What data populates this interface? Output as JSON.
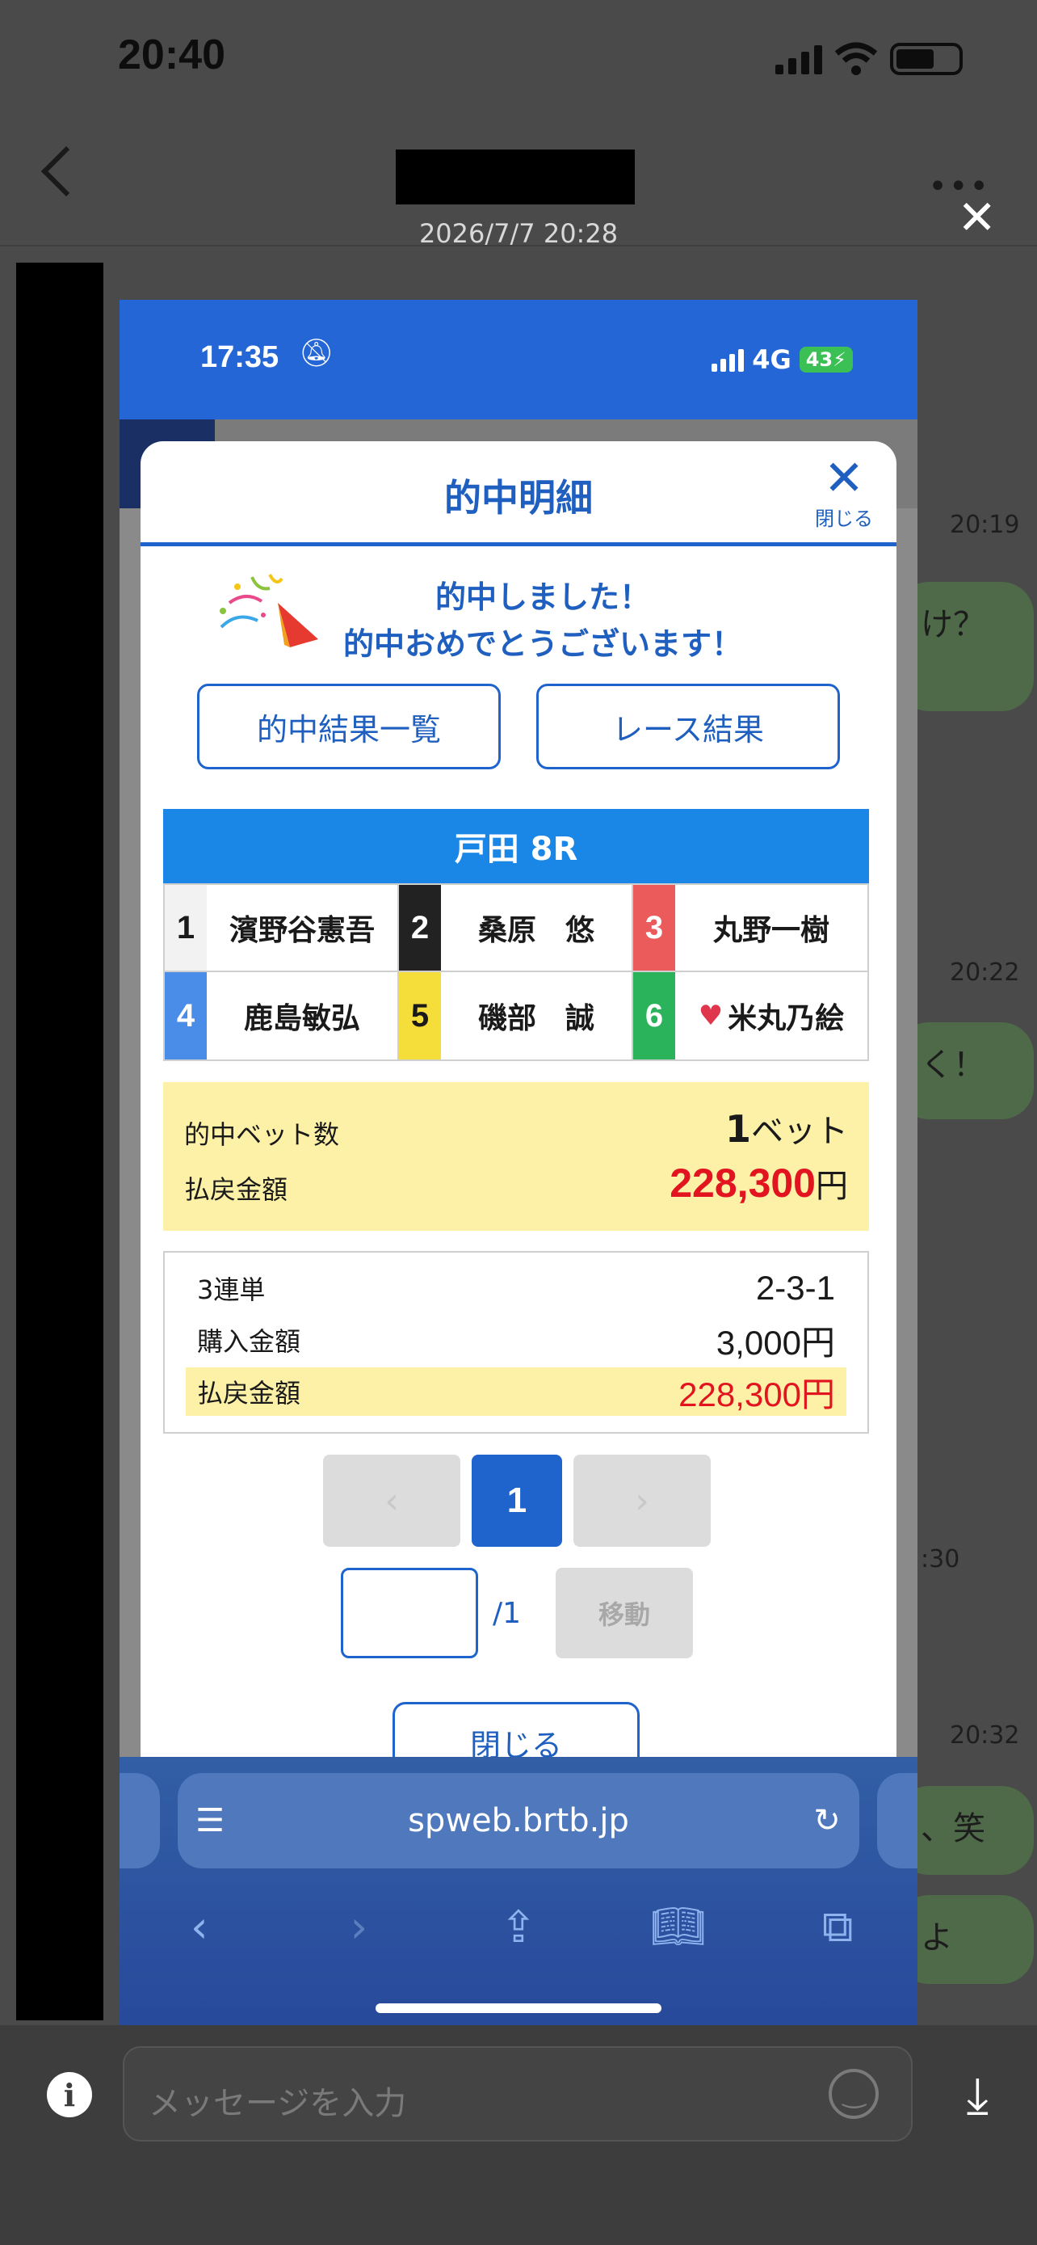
{
  "status": {
    "time": "20:40"
  },
  "chat": {
    "date": "2026/7/7 20:28",
    "times": [
      "20:19",
      "20:22",
      ":30",
      "20:32"
    ],
    "bubbles": [
      "け？",
      "く！",
      "、笑",
      "よ"
    ],
    "input_placeholder": "メッセージを入力"
  },
  "phone": {
    "time": "17:35",
    "network": "4G",
    "battery": "43"
  },
  "modal": {
    "title": "的中明細",
    "close_label": "閉じる",
    "congrats_line1": "的中しました！",
    "congrats_line2": "的中おめでとうございます！",
    "btn_results_list": "的中結果一覧",
    "btn_race_results": "レース結果",
    "race_title": "戸田 8R",
    "racers": [
      {
        "lane": "1",
        "name": "濱野谷憲吾",
        "color": "#f2f2f2",
        "text_color": "#1a1a1a"
      },
      {
        "lane": "2",
        "name": "桑原　悠",
        "color": "#222222",
        "text_color": "#ffffff"
      },
      {
        "lane": "3",
        "name": "丸野一樹",
        "color": "#ec5b5b",
        "text_color": "#ffffff"
      },
      {
        "lane": "4",
        "name": "鹿島敏弘",
        "color": "#4a8de8",
        "text_color": "#ffffff"
      },
      {
        "lane": "5",
        "name": "磯部　誠",
        "color": "#f5dd3a",
        "text_color": "#1a1a1a"
      },
      {
        "lane": "6",
        "name": "米丸乃絵",
        "color": "#2ab35a",
        "text_color": "#ffffff"
      }
    ],
    "summary": {
      "bet_count_label": "的中ベット数",
      "bet_count_num": "1",
      "bet_count_unit": "ベット",
      "payout_label": "払戻金額",
      "payout_value": "228,300",
      "payout_unit": "円"
    },
    "detail": {
      "type_label": "3連単",
      "type_value": "2-3-1",
      "purchase_label": "購入金額",
      "purchase_value": "3,000円",
      "payout_label": "払戻金額",
      "payout_value": "228,300円"
    },
    "pager": {
      "prev": "‹",
      "current": "1",
      "next": "›"
    },
    "jump": {
      "total": "/1",
      "button": "移動"
    },
    "close_button": "閉じる"
  },
  "safari": {
    "url": "spweb.brtb.jp"
  }
}
